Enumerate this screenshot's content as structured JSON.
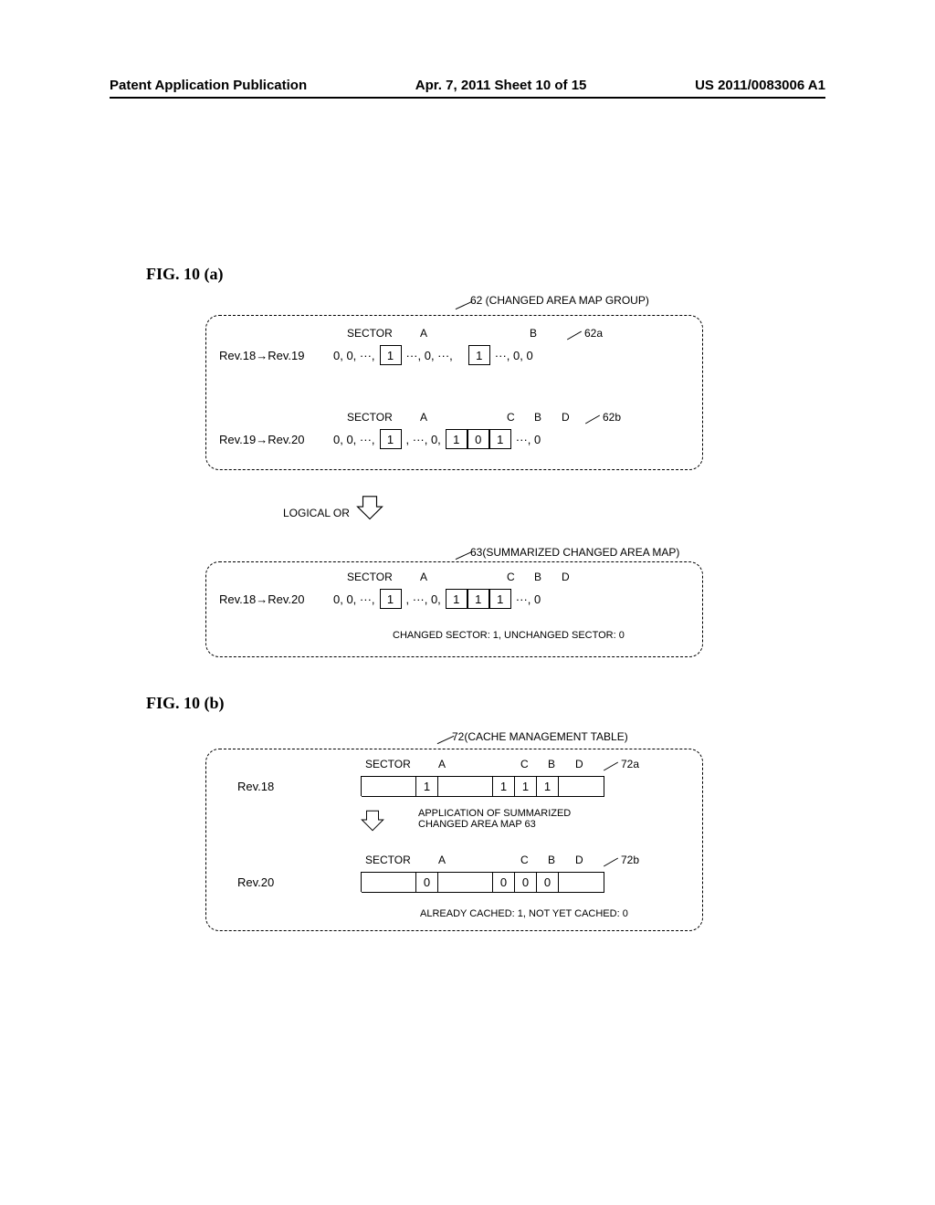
{
  "header": {
    "left": "Patent Application Publication",
    "center": "Apr. 7, 2011  Sheet 10 of 15",
    "right": "US 2011/0083006 A1"
  },
  "fig_a": {
    "label": "FIG. 10 (a)",
    "callout_62": "62 (CHANGED AREA MAP GROUP)",
    "callout_63": "63(SUMMARIZED CHANGED AREA MAP)",
    "logical_or": "LOGICAL OR",
    "note": "CHANGED SECTOR: 1, UNCHANGED SECTOR: 0",
    "row1": {
      "label": "Rev.18→Rev.19",
      "sector": "SECTOR",
      "sub": "62a",
      "colA": "A",
      "colB": "B",
      "pre": "0, 0, ···,",
      "valA": "1",
      "mid": "···, 0, ···,",
      "valB": "1",
      "post": "···, 0, 0"
    },
    "row2": {
      "label": "Rev.19→Rev.20",
      "sector": "SECTOR",
      "sub": "62b",
      "colA": "A",
      "colC": "C",
      "colB": "B",
      "colD": "D",
      "pre": "0, 0, ···,",
      "valA": "1",
      "mid": ", ···, 0,",
      "valC": "1",
      "valB": "0",
      "valD": "1",
      "post": "···, 0"
    },
    "row3": {
      "label": "Rev.18→Rev.20",
      "sector": "SECTOR",
      "colA": "A",
      "colC": "C",
      "colB": "B",
      "colD": "D",
      "pre": "0, 0, ···,",
      "valA": "1",
      "mid": ", ···, 0,",
      "valC": "1",
      "valB": "1",
      "valD": "1",
      "post": "···, 0"
    }
  },
  "fig_b": {
    "label": "FIG. 10 (b)",
    "callout_72": "72(CACHE MANAGEMENT TABLE)",
    "app_note": "APPLICATION OF SUMMARIZED CHANGED AREA MAP 63",
    "note": "ALREADY CACHED: 1, NOT YET CACHED: 0",
    "row1": {
      "label": "Rev.18",
      "sector": "SECTOR",
      "sub": "72a",
      "colA": "A",
      "colC": "C",
      "colB": "B",
      "colD": "D",
      "valA": "1",
      "valC": "1",
      "valB": "1",
      "valD": "1"
    },
    "row2": {
      "label": "Rev.20",
      "sector": "SECTOR",
      "sub": "72b",
      "colA": "A",
      "colC": "C",
      "colB": "B",
      "colD": "D",
      "valA": "0",
      "valC": "0",
      "valB": "0",
      "valD": "0"
    }
  }
}
